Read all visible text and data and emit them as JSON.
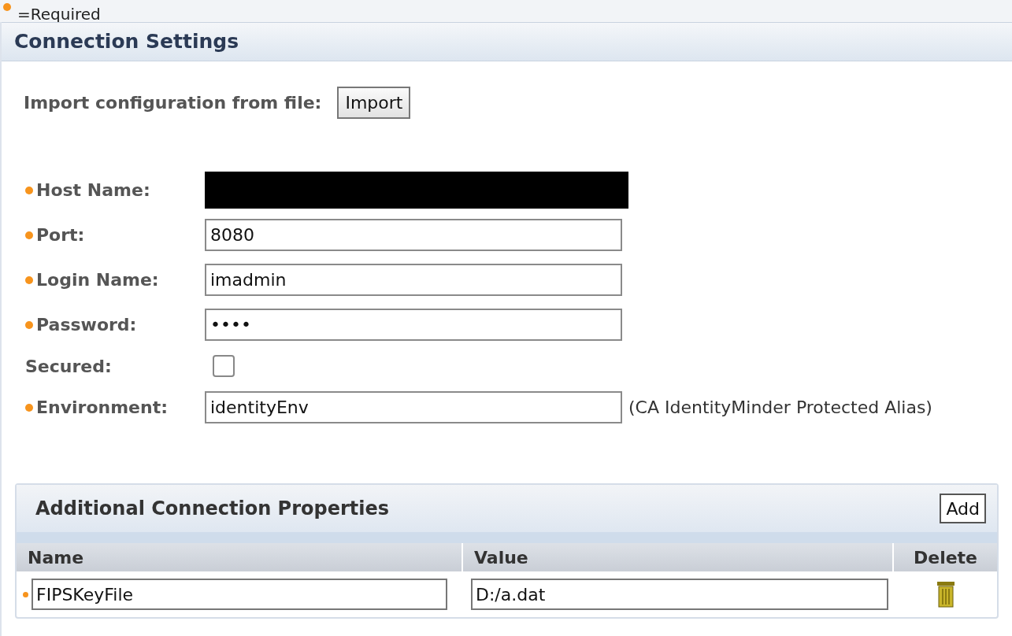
{
  "legend": {
    "text": "=Required"
  },
  "panel": {
    "title": "Connection Settings"
  },
  "import": {
    "label": "Import configuration from file:",
    "button": "Import"
  },
  "fields": [
    {
      "kind": "redacted",
      "label": "Host Name:",
      "required": true
    },
    {
      "kind": "text",
      "label": "Port:",
      "required": true,
      "value": "8080"
    },
    {
      "kind": "text",
      "label": "Login Name:",
      "required": true,
      "value": "imadmin"
    },
    {
      "kind": "text",
      "label": "Password:",
      "required": true,
      "value": "••••"
    },
    {
      "kind": "checkbox",
      "label": "Secured:",
      "required": false,
      "checked": false
    },
    {
      "kind": "text",
      "label": "Environment:",
      "required": true,
      "value": "identityEnv",
      "note": "(CA IdentityMinder Protected Alias)"
    }
  ],
  "properties": {
    "title": "Additional Connection Properties",
    "add_button": "Add",
    "columns": [
      "Name",
      "Value",
      "Delete"
    ],
    "rows": [
      {
        "required": true,
        "name": "FIPSKeyFile",
        "value": "D:/a.dat"
      }
    ]
  }
}
